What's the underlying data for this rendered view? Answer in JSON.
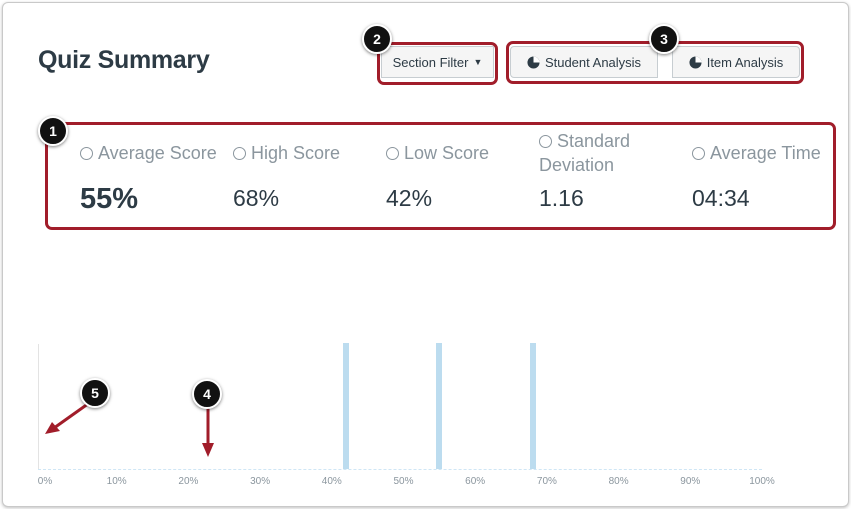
{
  "page": {
    "title": "Quiz Summary"
  },
  "toolbar": {
    "section_filter": "Section Filter",
    "student_analysis": "Student Analysis",
    "item_analysis": "Item Analysis"
  },
  "stats": [
    {
      "label": "Average Score",
      "value": "55%",
      "icon": "average-icon"
    },
    {
      "label": "High Score",
      "value": "68%",
      "icon": "high-score-icon"
    },
    {
      "label": "Low Score",
      "value": "42%",
      "icon": "low-score-icon"
    },
    {
      "label_line1": "Standard",
      "label_line2": "Deviation",
      "value": "1.16",
      "icon": "deviation-icon"
    },
    {
      "label": "Average Time",
      "value": "04:34",
      "icon": "clock-icon"
    }
  ],
  "callouts": [
    "1",
    "2",
    "3",
    "4",
    "5"
  ],
  "colors": {
    "accent": "#a11d2a",
    "bar": "#bcdcef",
    "text": "#2d3b45",
    "muted": "#8b969e"
  },
  "chart_data": {
    "type": "bar",
    "x_ticks": [
      "0%",
      "10%",
      "20%",
      "30%",
      "40%",
      "50%",
      "60%",
      "70%",
      "80%",
      "90%",
      "100%"
    ],
    "xlim": [
      0,
      100
    ],
    "x": [
      42,
      55,
      68
    ],
    "values": [
      1,
      1,
      1
    ],
    "grid": false
  }
}
